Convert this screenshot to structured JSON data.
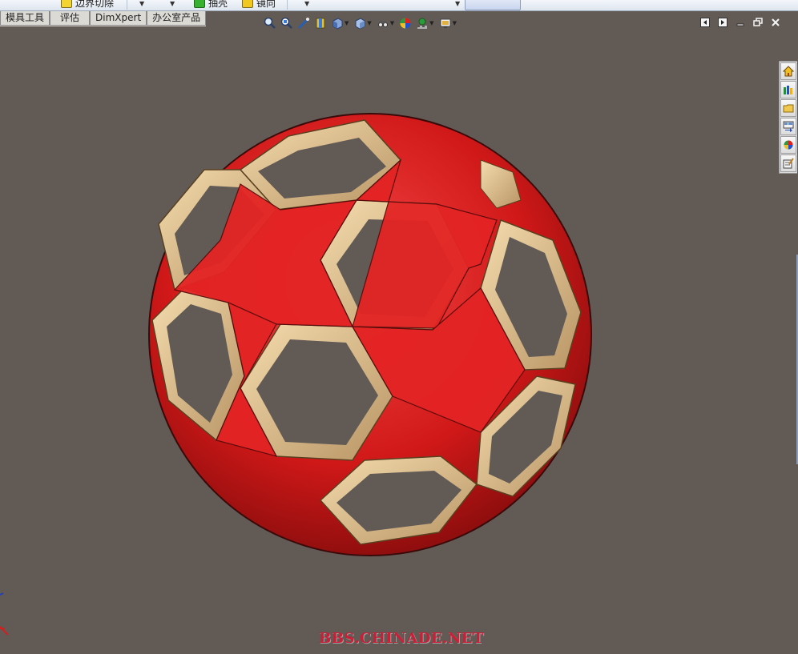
{
  "command_bar": {
    "items": [
      {
        "label": "边界切除",
        "icon": "yellow-feature-icon"
      },
      {
        "label": "抽壳",
        "icon": "shell-icon"
      },
      {
        "label": "镜向",
        "icon": "mirror-icon"
      }
    ]
  },
  "tabs": [
    "模具工具",
    "评估",
    "DimXpert",
    "办公室产品"
  ],
  "heads_up_toolbar": {
    "buttons": [
      "zoom-to-fit-icon",
      "zoom-to-area-icon",
      "previous-view-icon",
      "section-view-icon",
      "view-orientation-icon",
      "display-style-icon",
      "hide-show-items-icon",
      "edit-appearance-icon",
      "apply-scene-icon",
      "view-settings-icon"
    ]
  },
  "window_controls": [
    "tile-left-icon",
    "tile-right-icon",
    "minimize-icon",
    "restore-icon",
    "close-icon"
  ],
  "task_pane": [
    "solidworks-resources-icon",
    "design-library-icon",
    "file-explorer-icon",
    "view-palette-icon",
    "appearances-icon",
    "custom-properties-icon"
  ],
  "viewport": {
    "background": "#615a55",
    "model": "soccer-ball shell model",
    "colors": {
      "pentagon": "#d81818",
      "rim": "#d8b882",
      "hole": "#615a55"
    }
  },
  "watermark": "BBS.CHINADE.NET"
}
